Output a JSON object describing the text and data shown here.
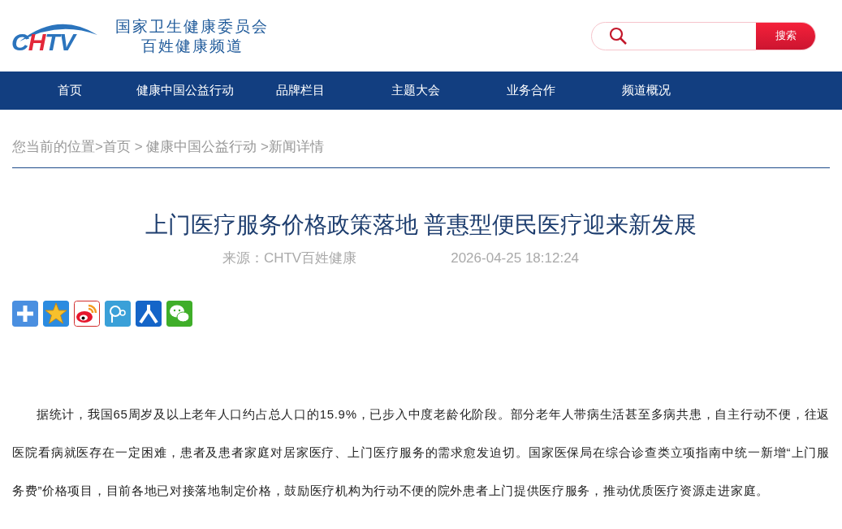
{
  "header": {
    "logo_letters": [
      {
        "char": "C",
        "color": "#2b74bd"
      },
      {
        "char": "H",
        "color": "#e3283a"
      },
      {
        "char": "T",
        "color": "#2b74bd"
      },
      {
        "char": "V",
        "color": "#2b74bd"
      }
    ],
    "org_name": "国家卫生健康委员会",
    "channel_name": "百姓健康频道",
    "search": {
      "button": "搜索"
    }
  },
  "nav": [
    {
      "label": "首页"
    },
    {
      "label": "健康中国公益行动"
    },
    {
      "label": "品牌栏目"
    },
    {
      "label": "主题大会"
    },
    {
      "label": "业务合作"
    },
    {
      "label": "频道概况"
    }
  ],
  "breadcrumb": "您当前的位置>首页 > 健康中国公益行动 >新闻详情",
  "article": {
    "title": "上门医疗服务价格政策落地 普惠型便民医疗迎来新发展",
    "source": "来源：CHTV百姓健康",
    "date": "2026-04-25 18:12:24",
    "share": [
      {
        "kind": "more"
      },
      {
        "kind": "qzone"
      },
      {
        "kind": "weibo"
      },
      {
        "kind": "tqq"
      },
      {
        "kind": "renren"
      },
      {
        "kind": "wechat"
      }
    ],
    "paragraphs": [
      "据统计，我国65周岁及以上老年人口约占总人口的15.9%，已步入中度老龄化阶段。部分老年人带病生活甚至多病共患，自主行动不便，往返医院看病就医存在一定困难，患者及患者家庭对居家医疗、上门医疗服务的需求愈发迫切。国家医保局在综合诊查类立项指南中统一新增“上门服务费”价格项目，目前各地已对接落地制定价格，鼓励医疗机构为行动不便的院外患者上门提供医疗服务，推动优质医疗资源走进家庭。"
    ]
  }
}
